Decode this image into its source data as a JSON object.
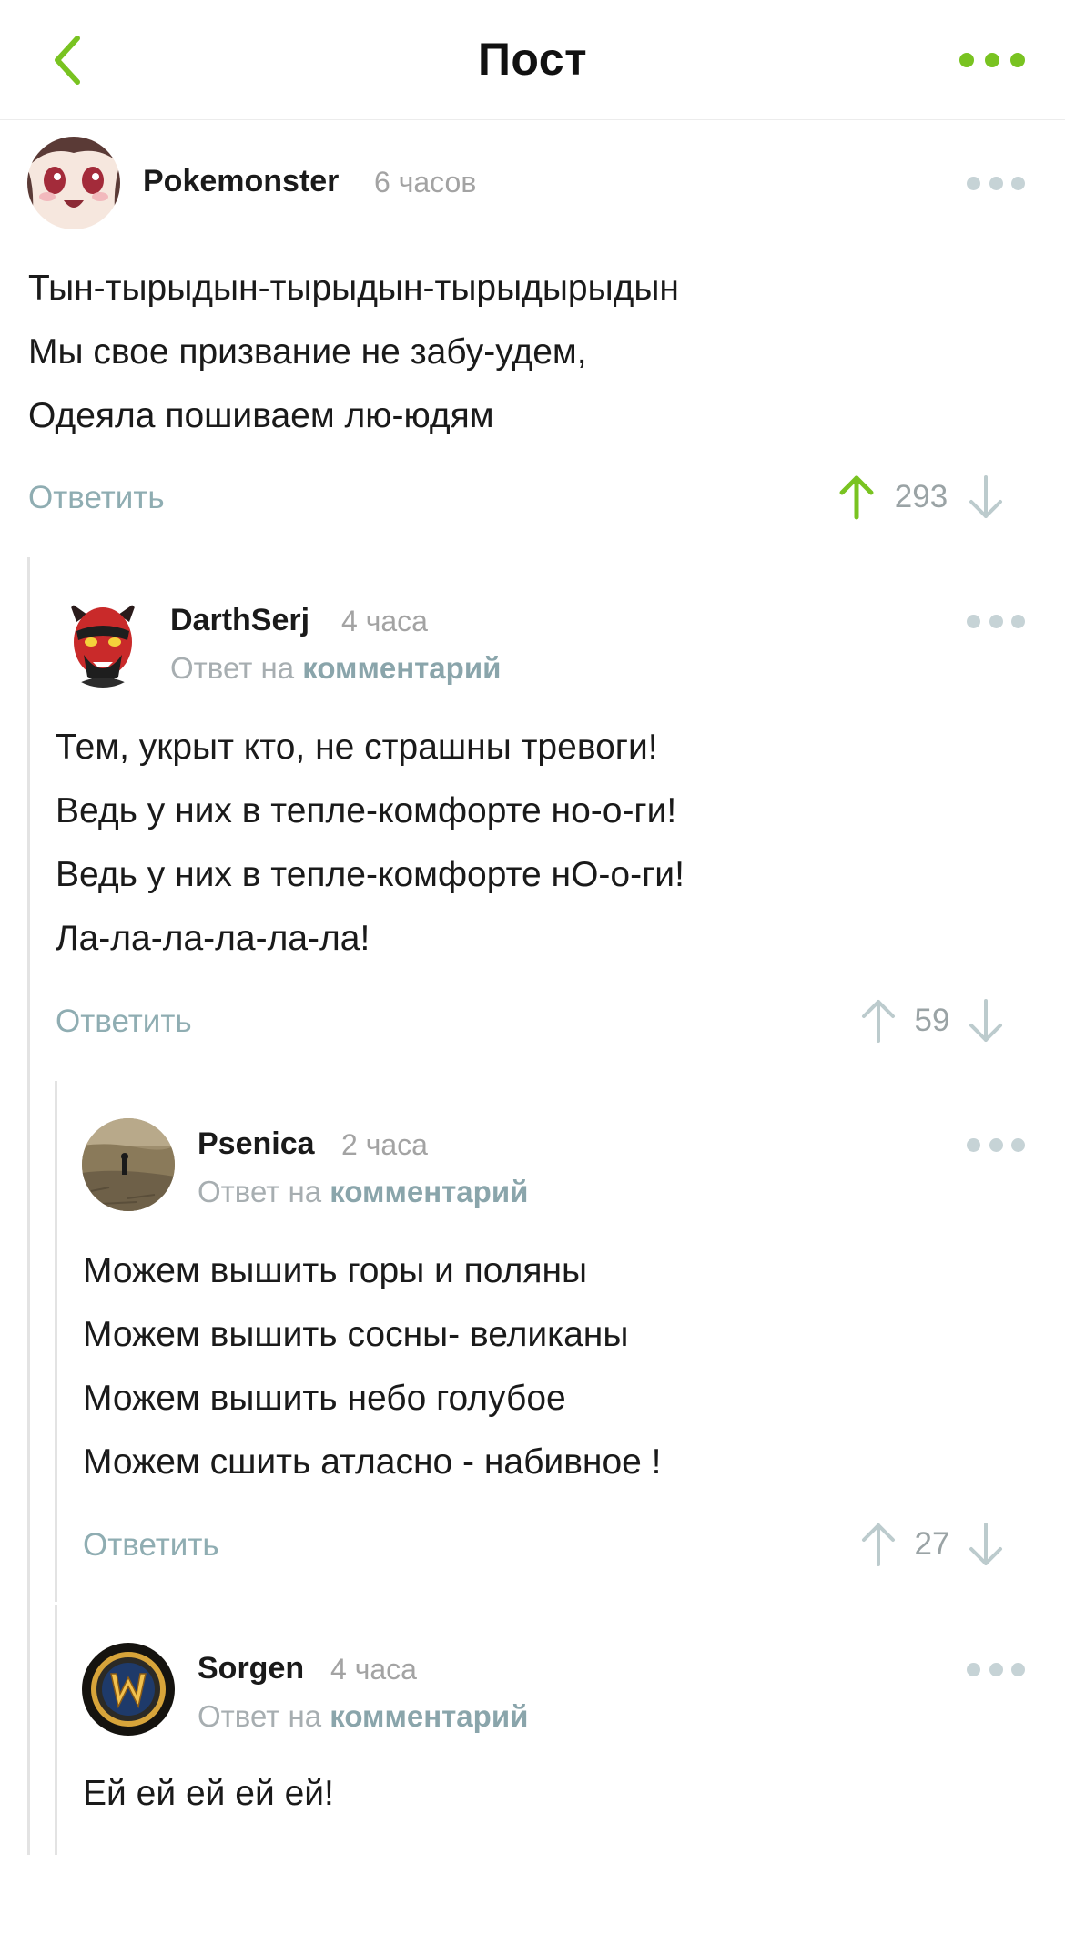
{
  "header": {
    "title": "Пост"
  },
  "colors": {
    "accent": "#79c321",
    "muted_link": "#8aa5ab",
    "time": "#a3a3a3"
  },
  "comments": [
    {
      "author": "Pokemonster",
      "time": "6 часов",
      "reply_prefix": "",
      "reply_link": "",
      "lines": [
        "Тын-тырыдын-тырыдын-тырыдырыдын",
        "Мы свое призвание не забу-удем,",
        "Одеяла пошиваем лю-юдям"
      ],
      "reply_label": "Ответить",
      "rating": "293",
      "upvoted": true
    },
    {
      "author": "DarthSerj",
      "time": "4 часа",
      "reply_prefix": "Ответ на",
      "reply_link": "комментарий",
      "lines": [
        "Тем, укрыт кто, не страшны тревоги!",
        "Ведь у них в тепле-комфорте но-о-ги!",
        "Ведь у них в тепле-комфорте нО-о-ги!",
        "Ла-ла-ла-ла-ла-ла!"
      ],
      "reply_label": "Ответить",
      "rating": "59",
      "upvoted": false
    },
    {
      "author": "Psenica",
      "time": "2 часа",
      "reply_prefix": "Ответ на",
      "reply_link": "комментарий",
      "lines": [
        "Можем вышить горы и поляны",
        "Можем вышить сосны- великаны",
        "Можем вышить небо голубое",
        "Можем сшить атласно - набивное !"
      ],
      "reply_label": "Ответить",
      "rating": "27",
      "upvoted": false
    },
    {
      "author": "Sorgen",
      "time": "4 часа",
      "reply_prefix": "Ответ на",
      "reply_link": "комментарий",
      "lines": [
        "Ей ей ей ей ей!"
      ],
      "reply_label": "",
      "rating": "",
      "upvoted": false
    }
  ]
}
